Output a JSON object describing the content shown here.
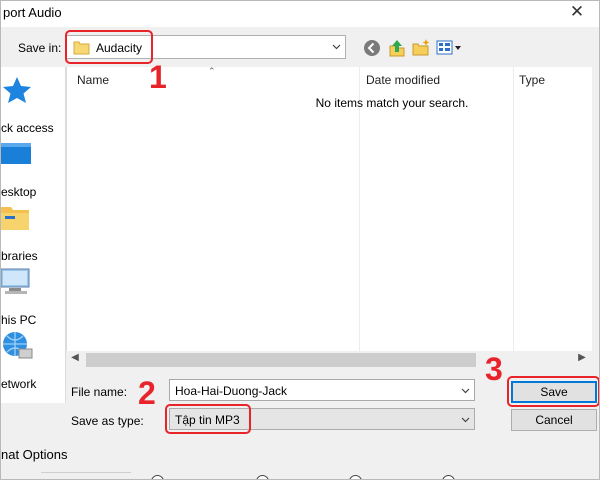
{
  "window": {
    "title": "port Audio",
    "close_glyph": "✕"
  },
  "save_in": {
    "label": "Save in:",
    "value": "Audacity"
  },
  "toolbar": {
    "icons": [
      "back-icon",
      "up-folder-icon",
      "new-folder-icon",
      "view-menu-icon"
    ]
  },
  "places": [
    {
      "label": "ck access",
      "icon": "star-icon"
    },
    {
      "label": "esktop",
      "icon": "desktop-icon"
    },
    {
      "label": "braries",
      "icon": "libraries-icon"
    },
    {
      "label": "his PC",
      "icon": "computer-icon"
    },
    {
      "label": "etwork",
      "icon": "network-icon"
    }
  ],
  "file_list": {
    "columns": [
      "Name",
      "Date modified",
      "Type"
    ],
    "empty_message": "No items match your search."
  },
  "file_name": {
    "label": "File name:",
    "value": "Hoa-Hai-Duong-Jack"
  },
  "save_as_type": {
    "label": "Save as type:",
    "value": "Tập tin MP3"
  },
  "buttons": {
    "save": "Save",
    "cancel": "Cancel"
  },
  "annotations": {
    "one": "1",
    "two": "2",
    "three": "3",
    "color": "#e8232a"
  },
  "options": {
    "heading": "nat Options"
  }
}
